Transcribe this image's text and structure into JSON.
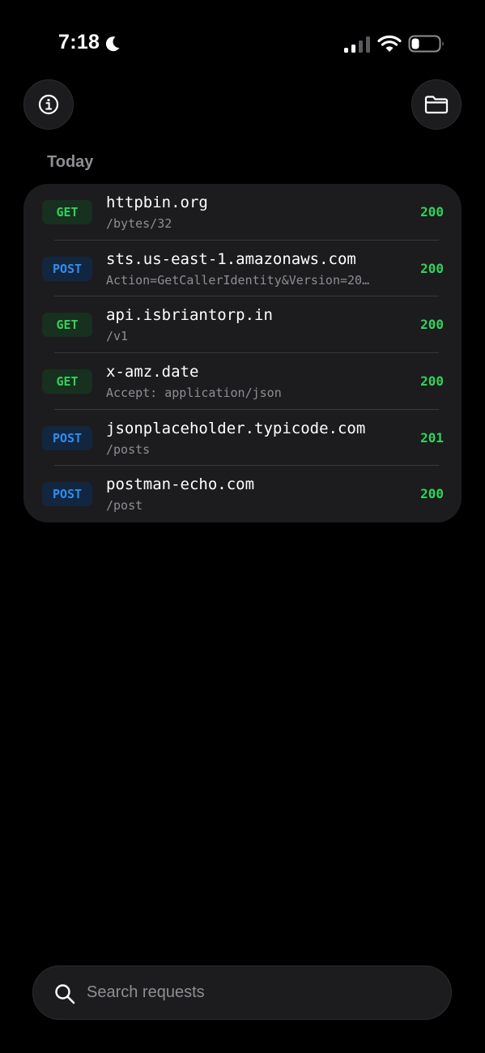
{
  "status_bar": {
    "time": "7:18",
    "icons": [
      "moon-icon",
      "signal-icon",
      "wifi-icon",
      "battery-icon"
    ]
  },
  "toolbar": {
    "left_icon": "info-icon",
    "right_icon": "folder-icon"
  },
  "section": {
    "title": "Today"
  },
  "requests": [
    {
      "method": "GET",
      "host": "httpbin.org",
      "path": "/bytes/32",
      "status": "200"
    },
    {
      "method": "POST",
      "host": "sts.us-east-1.amazonaws.com",
      "path": "Action=GetCallerIdentity&Version=20…",
      "status": "200"
    },
    {
      "method": "GET",
      "host": "api.isbriantorp.in",
      "path": "/v1",
      "status": "200"
    },
    {
      "method": "GET",
      "host": "x-amz.date",
      "path": "Accept: application/json",
      "status": "200"
    },
    {
      "method": "POST",
      "host": "jsonplaceholder.typicode.com",
      "path": "/posts",
      "status": "201"
    },
    {
      "method": "POST",
      "host": "postman-echo.com",
      "path": "/post",
      "status": "200"
    }
  ],
  "search": {
    "placeholder": "Search requests",
    "value": ""
  },
  "colors": {
    "background": "#000000",
    "card": "#1c1c1e",
    "get": "#32d15a",
    "post": "#2f8df0",
    "status_ok": "#32d15a",
    "secondary_text": "#8e8e93"
  }
}
